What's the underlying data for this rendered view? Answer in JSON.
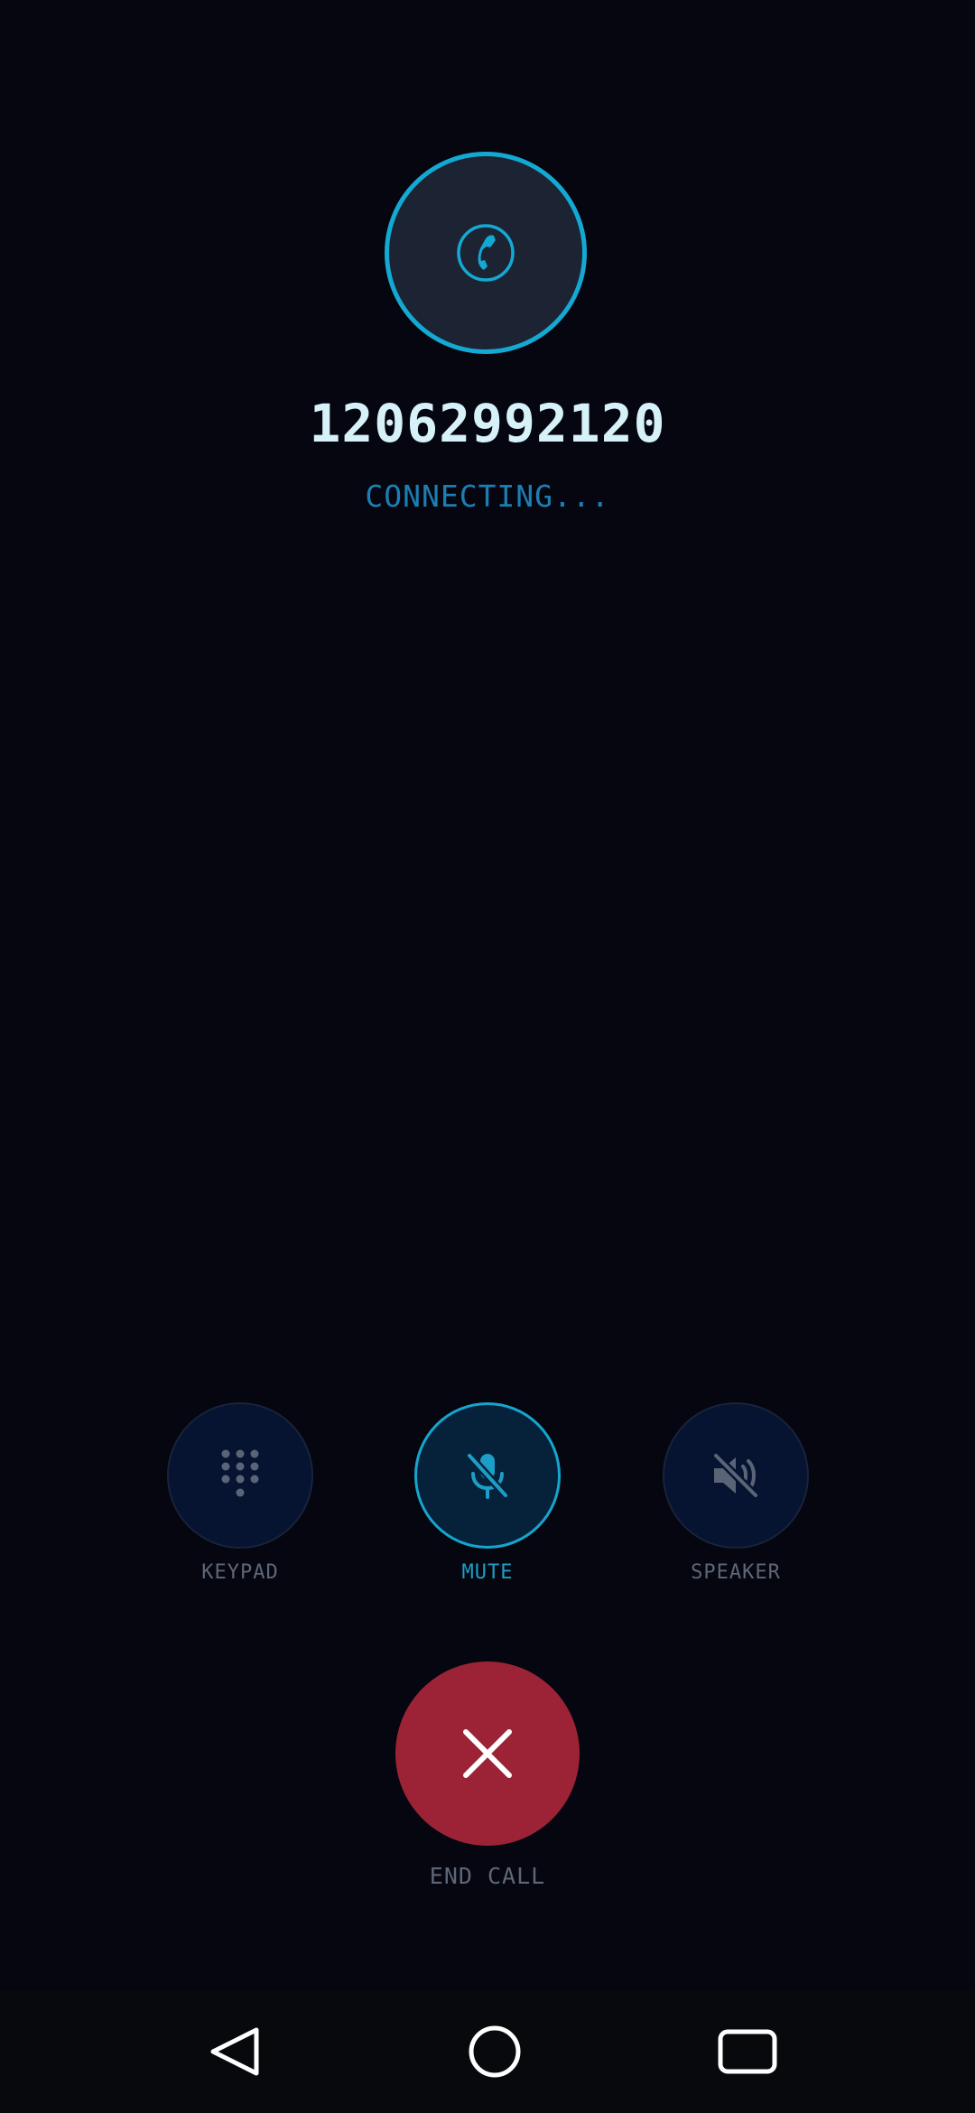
{
  "call": {
    "number": "12062992120",
    "status": "CONNECTING..."
  },
  "controls": [
    {
      "label": "KEYPAD",
      "icon": "keypad-icon",
      "active": false
    },
    {
      "label": "MUTE",
      "icon": "mic-off-icon",
      "active": true
    },
    {
      "label": "SPEAKER",
      "icon": "volume-off-icon",
      "active": false
    }
  ],
  "end_call": {
    "label": "END CALL",
    "icon": "close-icon"
  },
  "navbar": {
    "back_icon": "back-triangle-icon",
    "home_icon": "home-circle-icon",
    "recents_icon": "recents-square-icon"
  },
  "colors": {
    "background": "#05060f",
    "accent": "#14a9d2",
    "end_call": "#9c2335",
    "inactive_text": "#5e6778"
  }
}
